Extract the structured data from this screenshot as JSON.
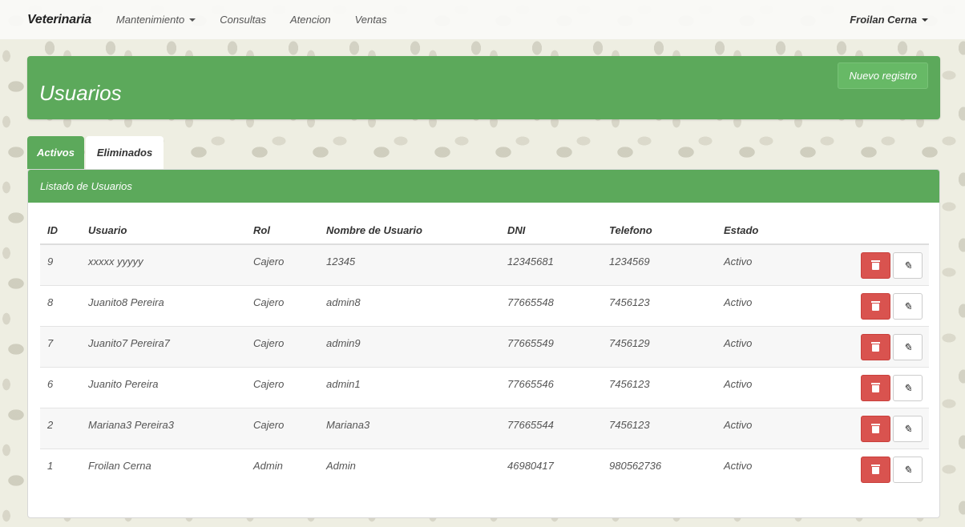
{
  "navbar": {
    "brand": "Veterinaria",
    "links": [
      "Mantenimiento",
      "Consultas",
      "Atencion",
      "Ventas"
    ],
    "user": "Froilan Cerna"
  },
  "header": {
    "title": "Usuarios",
    "new_button": "Nuevo registro"
  },
  "tabs": [
    "Activos",
    "Eliminados"
  ],
  "list": {
    "heading": "Listado de Usuarios",
    "columns": [
      "ID",
      "Usuario",
      "Rol",
      "Nombre de Usuario",
      "DNI",
      "Telefono",
      "Estado"
    ],
    "rows": [
      {
        "id": "9",
        "usuario": "xxxxx yyyyy",
        "rol": "Cajero",
        "nombre": "12345",
        "dni": "12345681",
        "telefono": "1234569",
        "estado": "Activo"
      },
      {
        "id": "8",
        "usuario": "Juanito8 Pereira",
        "rol": "Cajero",
        "nombre": "admin8",
        "dni": "77665548",
        "telefono": "7456123",
        "estado": "Activo"
      },
      {
        "id": "7",
        "usuario": "Juanito7 Pereira7",
        "rol": "Cajero",
        "nombre": "admin9",
        "dni": "77665549",
        "telefono": "7456129",
        "estado": "Activo"
      },
      {
        "id": "6",
        "usuario": "Juanito Pereira",
        "rol": "Cajero",
        "nombre": "admin1",
        "dni": "77665546",
        "telefono": "7456123",
        "estado": "Activo"
      },
      {
        "id": "2",
        "usuario": "Mariana3 Pereira3",
        "rol": "Cajero",
        "nombre": "Mariana3",
        "dni": "77665544",
        "telefono": "7456123",
        "estado": "Activo"
      },
      {
        "id": "1",
        "usuario": "Froilan Cerna",
        "rol": "Admin",
        "nombre": "Admin",
        "dni": "46980417",
        "telefono": "980562736",
        "estado": "Activo"
      }
    ]
  },
  "colors": {
    "primary": "#5ca95b",
    "danger": "#d9534f"
  },
  "icons": {
    "delete": "trash-icon",
    "edit": "pencil-icon"
  }
}
